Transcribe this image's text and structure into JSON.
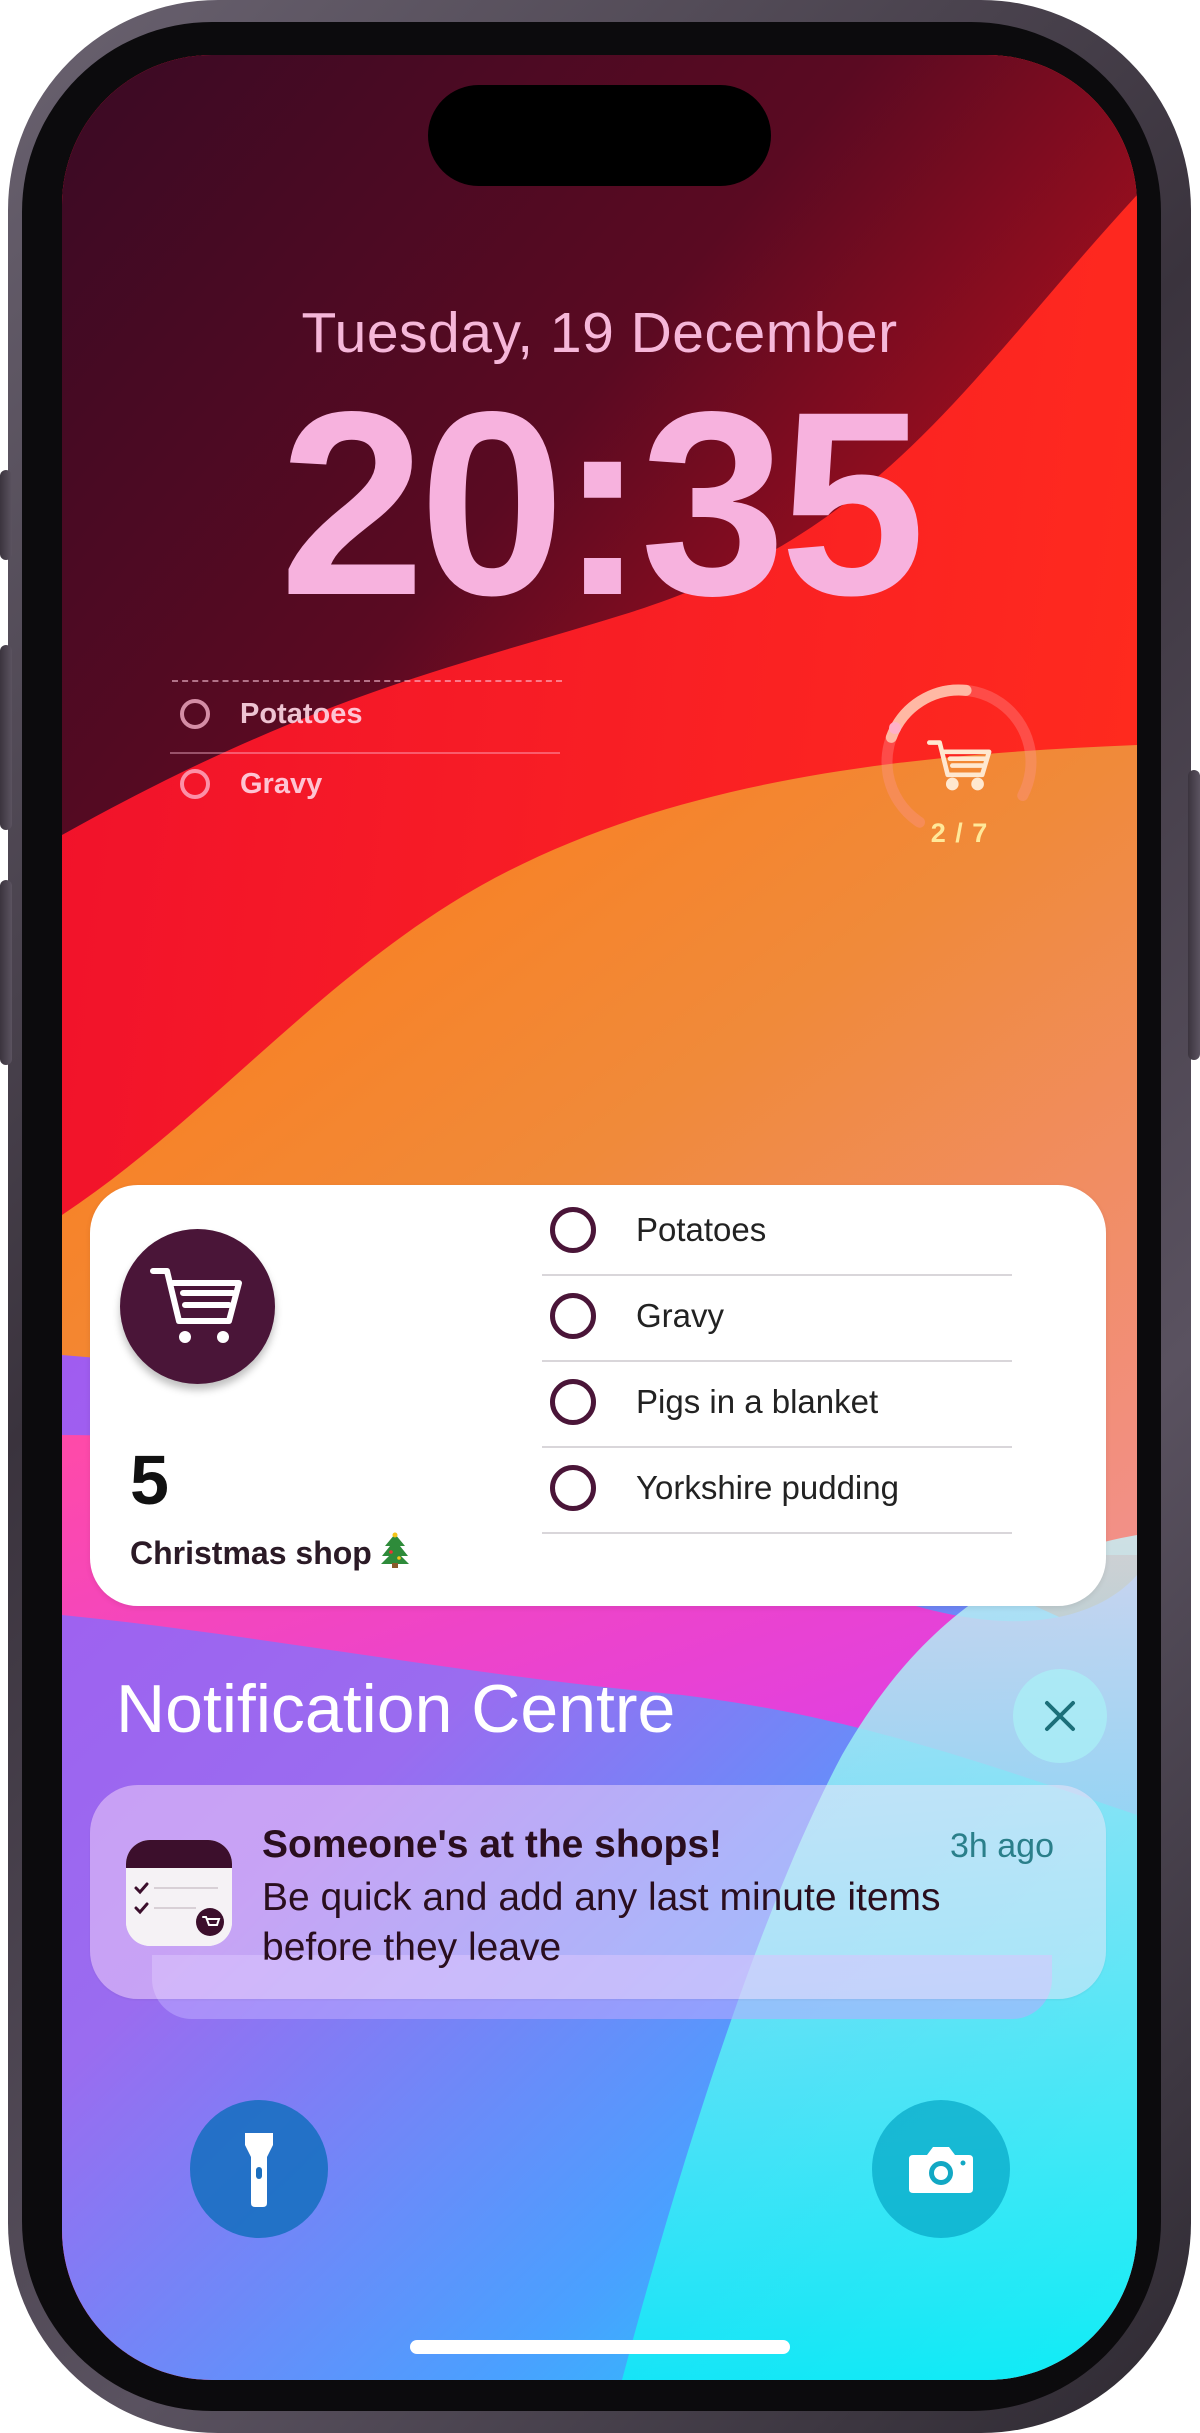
{
  "lock_screen": {
    "date": "Tuesday, 19 December",
    "time": "20:35"
  },
  "mini_list_widget": {
    "items": [
      "Potatoes",
      "Gravy"
    ]
  },
  "progress_widget": {
    "label": "2 / 7",
    "progress_fraction": 0.2857,
    "icon": "cart-icon"
  },
  "list_widget": {
    "count": "5",
    "list_name": "Christmas shop",
    "list_emoji_icon": "christmas-tree-icon",
    "items": [
      "Potatoes",
      "Gravy",
      "Pigs in a blanket",
      "Yorkshire pudding"
    ],
    "accent_color": "#4a1538"
  },
  "notification_centre": {
    "title": "Notification Centre",
    "close_icon": "close-icon",
    "notification": {
      "title": "Someone's at the shops!",
      "time": "3h ago",
      "body": "Be quick and add any last minute items before they leave"
    }
  },
  "controls": {
    "left": "flashlight-icon",
    "right": "camera-icon"
  }
}
